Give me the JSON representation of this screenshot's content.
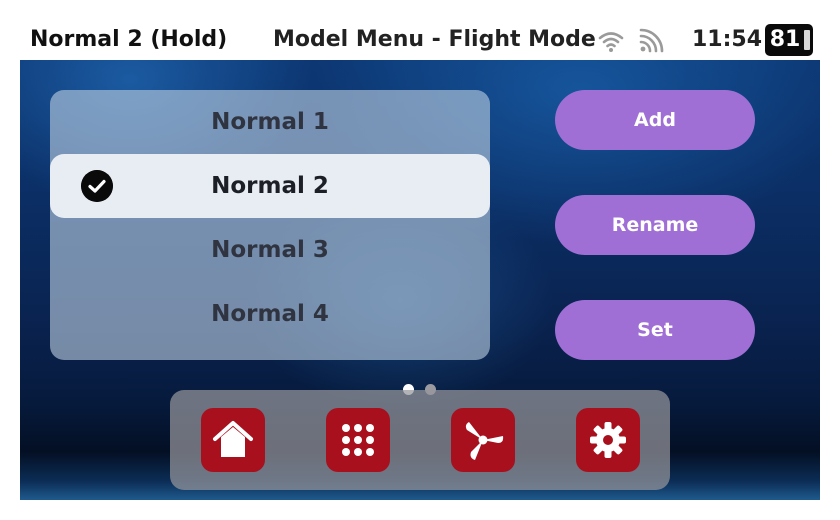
{
  "status_bar": {
    "model_name": "Normal 2 (Hold)",
    "title": "Model Menu - Flight Mode",
    "time": "11:54",
    "battery": "81",
    "wifi_icon": "wifi-icon",
    "signal_icon": "signal-icon"
  },
  "flight_modes": {
    "items": [
      {
        "label": "Normal 1",
        "selected": false
      },
      {
        "label": "Normal 2",
        "selected": true
      },
      {
        "label": "Normal 3",
        "selected": false
      },
      {
        "label": "Normal 4",
        "selected": false
      }
    ],
    "selected_icon": "check-circle-icon"
  },
  "actions": {
    "add_label": "Add",
    "rename_label": "Rename",
    "set_label": "Set",
    "color": "#a06fd6"
  },
  "pager": {
    "current": 1,
    "total": 2
  },
  "dock": {
    "buttons": [
      {
        "icon": "home-icon"
      },
      {
        "icon": "apps-grid-icon"
      },
      {
        "icon": "propeller-icon"
      },
      {
        "icon": "settings-gear-icon"
      }
    ],
    "accent": "#a8101e"
  }
}
